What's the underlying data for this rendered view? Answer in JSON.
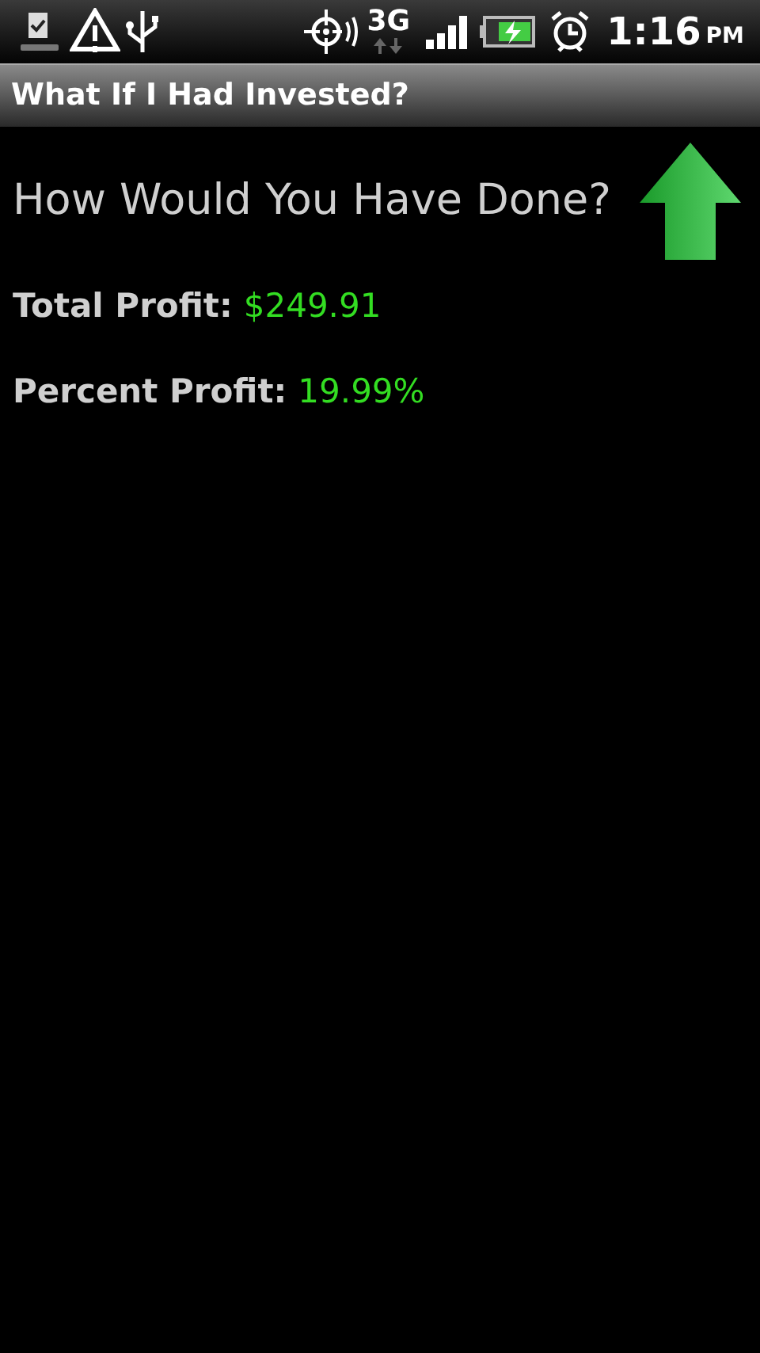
{
  "status_bar": {
    "network": "3G",
    "time": "1:16",
    "meridiem": "PM"
  },
  "title_bar": {
    "title": "What If I Had Invested?"
  },
  "heading": "How Would You Have Done?",
  "stats": [
    {
      "label": "Total Profit:",
      "value": "$249.91"
    },
    {
      "label": "Percent Profit:",
      "value": "19.99%"
    }
  ]
}
